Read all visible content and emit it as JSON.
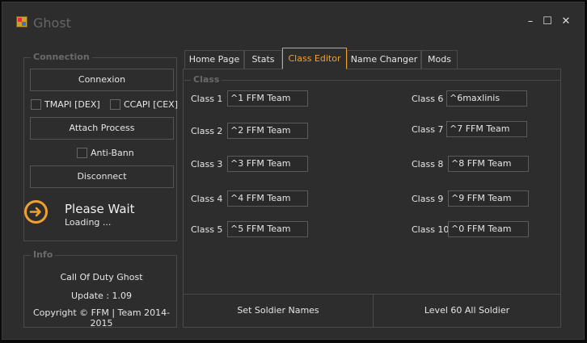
{
  "window": {
    "title": "Ghost",
    "minimize": "–",
    "maximize": "☐",
    "close": "✕"
  },
  "connection": {
    "title": "Connexion",
    "connect_label": "Connexion",
    "tmapi_label": "TMAPI [DEX]",
    "ccapi_label": "CCAPI [CEX]",
    "attach_label": "Attach Process",
    "antiban_label": "Anti-Bann",
    "disconnect_label": "Disconnect"
  },
  "group_connection": "Connection",
  "status": {
    "title": "Please Wait",
    "subtitle": "Loading ...",
    "accent": "#f0a030"
  },
  "info": {
    "title": "Info",
    "line1": "Call Of Duty Ghost",
    "line2": "Update : 1.09",
    "line3": "Copyright © FFM | Team 2014-2015"
  },
  "tabs": [
    {
      "label": "Home Page"
    },
    {
      "label": "Stats"
    },
    {
      "label": "Class Editor"
    },
    {
      "label": "Name Changer"
    },
    {
      "label": "Mods"
    }
  ],
  "class_editor": {
    "group_title": "Class",
    "left": [
      {
        "label": "Class 1",
        "value": "^1 FFM Team"
      },
      {
        "label": "Class 2",
        "value": "^2 FFM Team"
      },
      {
        "label": "Class 3",
        "value": "^3 FFM Team"
      },
      {
        "label": "Class 4",
        "value": "^4 FFM Team"
      },
      {
        "label": "Class 5",
        "value": "^5 FFM Team"
      }
    ],
    "right": [
      {
        "label": "Class 6",
        "value": "^6maxlinis"
      },
      {
        "label": "Class 7",
        "value": "^7 FFM Team"
      },
      {
        "label": "Class 8",
        "value": "^8 FFM Team"
      },
      {
        "label": "Class 9",
        "value": "^9 FFM Team"
      },
      {
        "label": "Class 10",
        "value": "^0 FFM Team"
      }
    ],
    "set_names_label": "Set Soldier Names",
    "level60_label": "Level 60 All Soldier"
  }
}
